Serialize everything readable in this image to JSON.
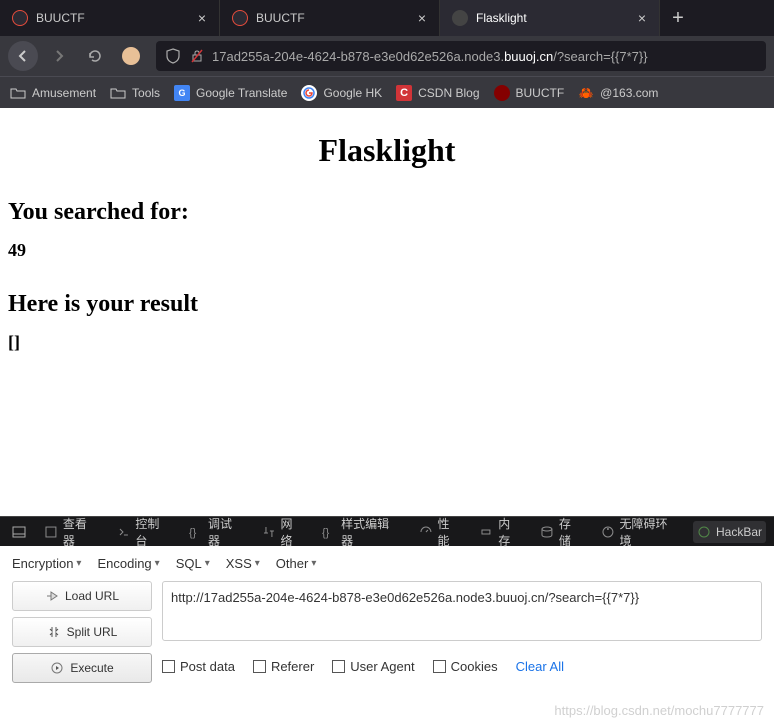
{
  "tabs": [
    {
      "title": "BUUCTF",
      "active": false,
      "icon": "red"
    },
    {
      "title": "BUUCTF",
      "active": false,
      "icon": "red"
    },
    {
      "title": "Flasklight",
      "active": true,
      "icon": "globe"
    }
  ],
  "url": {
    "prefix": "17ad255a-204e-4624-b878-e3e0d62e526a.node3.",
    "domain": "buuoj.cn",
    "suffix": "/?search={{7*7}}"
  },
  "bookmarks": [
    {
      "label": "Amusement",
      "type": "folder"
    },
    {
      "label": "Tools",
      "type": "folder"
    },
    {
      "label": "Google Translate",
      "type": "blue"
    },
    {
      "label": "Google HK",
      "type": "g"
    },
    {
      "label": "CSDN Blog",
      "type": "red"
    },
    {
      "label": "BUUCTF",
      "type": "dark"
    },
    {
      "label": "@163.com",
      "type": "crab"
    }
  ],
  "page": {
    "title": "Flasklight",
    "searched_label": "You searched for:",
    "searched_value": "49",
    "result_label": "Here is your result",
    "result_value": "[]"
  },
  "devtools": {
    "inspector": "查看器",
    "console": "控制台",
    "debugger": "调试器",
    "network": "网络",
    "styleeditor": "样式编辑器",
    "performance": "性能",
    "memory": "内存",
    "storage": "存储",
    "accessibility": "无障碍环境",
    "hackbar": "HackBar"
  },
  "hackbar": {
    "menu": [
      "Encryption",
      "Encoding",
      "SQL",
      "XSS",
      "Other"
    ],
    "buttons": {
      "load": "Load URL",
      "split": "Split URL",
      "execute": "Execute"
    },
    "url": "http://17ad255a-204e-4624-b878-e3e0d62e526a.node3.buuoj.cn/?search={{7*7}}",
    "options": {
      "postdata": "Post data",
      "referer": "Referer",
      "useragent": "User Agent",
      "cookies": "Cookies",
      "clear": "Clear All"
    }
  },
  "watermark": "https://blog.csdn.net/mochu7777777"
}
